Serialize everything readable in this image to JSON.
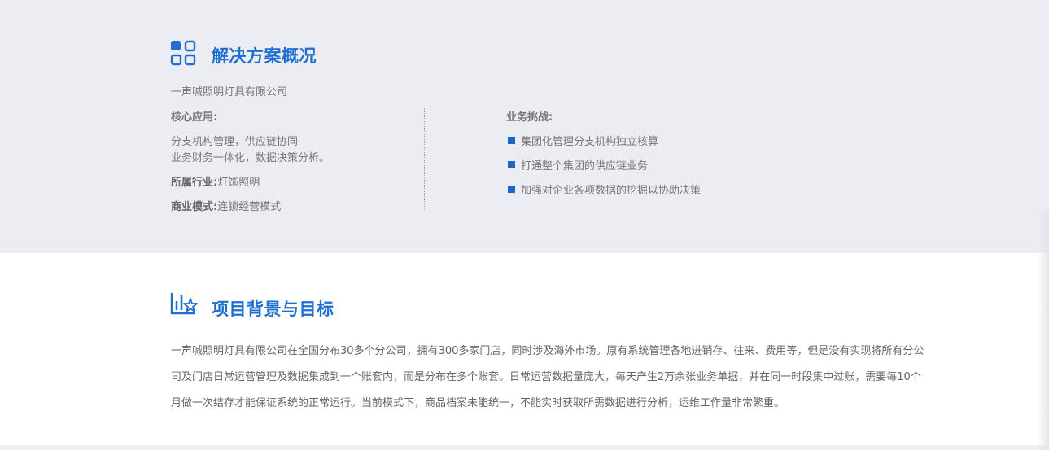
{
  "overview": {
    "title": "解决方案概况",
    "icon": "grid-icon",
    "company": "一声喊照明灯具有限公司",
    "core_label": "核心应用:",
    "core_lines": [
      "分支机构管理，供应链协同",
      "业务财务一体化，数据决策分析。"
    ],
    "industry_label": "所属行业:",
    "industry_value": "灯饰照明",
    "model_label": "商业模式:",
    "model_value": "连锁经营模式",
    "challenges_label": "业务挑战:",
    "challenges": [
      "集团化管理分支机构独立核算",
      "打通整个集团的供应链业务",
      "加强对企业各项数据的挖掘以协助决策"
    ]
  },
  "background": {
    "title": "项目背景与目标",
    "icon": "chart-star-icon",
    "lines": [
      "一声喊照明灯具有限公司在全国分布30多个分公司，拥有300多家门店，同时涉及海外市场。原有系统管理各地进销存、往来、费用等，但是没有实现将所有分公",
      "司及门店日常运营管理及数据集成到一个账套内，而是分布在多个账套。日常运营数据量庞大，每天产生2万余张业务单据，并在同一时段集中过账，需要每10个",
      "月做一次结存才能保证系统的正常运行。当前模式下，商品档案未能统一，不能实时获取所需数据进行分析，运维工作量非常繁重。"
    ]
  },
  "colors": {
    "accent": "#1f6fd1",
    "section_bg": "#ecedf2",
    "bullet": "#1a66c9"
  }
}
